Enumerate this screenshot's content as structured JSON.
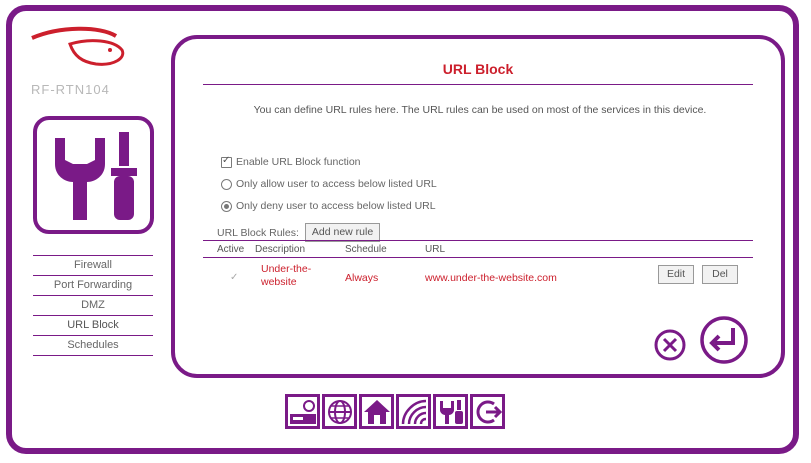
{
  "brand": {
    "model": "RF-RTN104",
    "logo_icon": "rabbit-logo-icon"
  },
  "side_tile_icon": "tools-icon",
  "nav": {
    "items": [
      {
        "label": "Firewall"
      },
      {
        "label": "Port Forwarding"
      },
      {
        "label": "DMZ"
      },
      {
        "label": "URL Block",
        "active": true
      },
      {
        "label": "Schedules"
      }
    ]
  },
  "panel": {
    "title": "URL Block",
    "description": "You can define URL rules here. The URL rules can be used on most of the services in this device.",
    "enable_label": "Enable URL Block function",
    "enable_checked": true,
    "option_allow": "Only allow user to access below listed URL",
    "option_deny": "Only deny user to access below listed URL",
    "selected_option": "deny",
    "rules_label": "URL Block Rules:",
    "add_rule_button": "Add new rule",
    "columns": {
      "active": "Active",
      "description": "Description",
      "schedule": "Schedule",
      "url": "URL"
    },
    "rows": [
      {
        "active": "✓",
        "description": "Under-the-website",
        "schedule": "Always",
        "url": "www.under-the-website.com",
        "edit_label": "Edit",
        "delete_label": "Del"
      }
    ]
  },
  "actions": {
    "cancel_icon": "cancel-icon",
    "apply_icon": "enter-icon"
  },
  "toolbar": {
    "icons": [
      "router-status-icon",
      "internet-icon",
      "home-network-icon",
      "wireless-icon",
      "tools-icon",
      "logout-icon"
    ]
  },
  "colors": {
    "frame": "#7a1a87",
    "accent_red": "#cc1f2c",
    "text": "#666666"
  }
}
